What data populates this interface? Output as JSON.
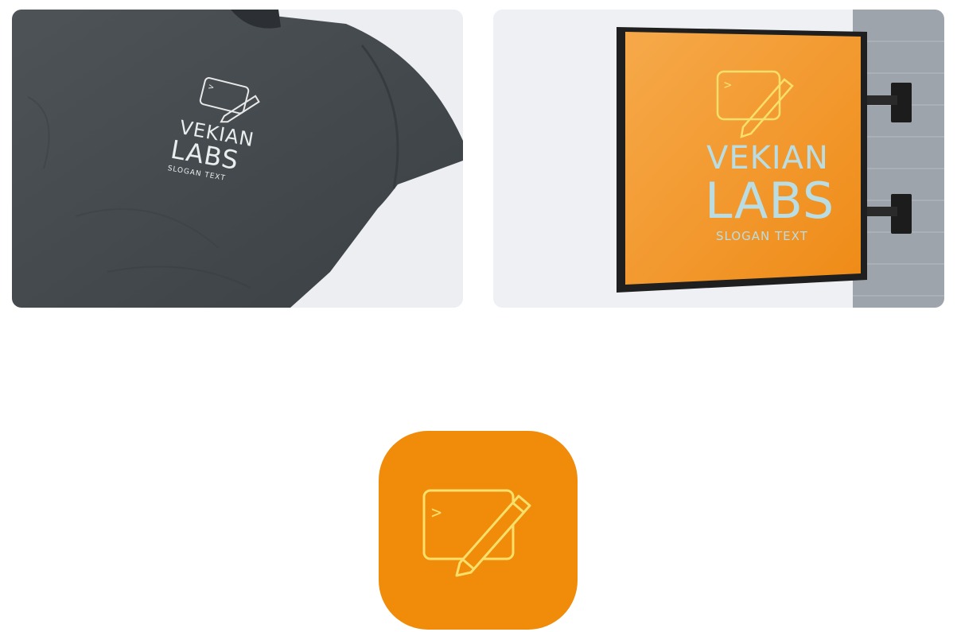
{
  "brand": {
    "name_line1": "VEKIAN",
    "name_line2": "LABS",
    "slogan": "SLOGAN TEXT"
  },
  "icons": {
    "logo": "terminal-pencil-icon",
    "prompt_glyph": ">"
  },
  "colors": {
    "brand_orange": "#f08c0a",
    "logo_yellow": "#f7e06a",
    "text_blue": "#b9dde3",
    "shirt": "#43494d",
    "wall": "#9ea4ab"
  }
}
